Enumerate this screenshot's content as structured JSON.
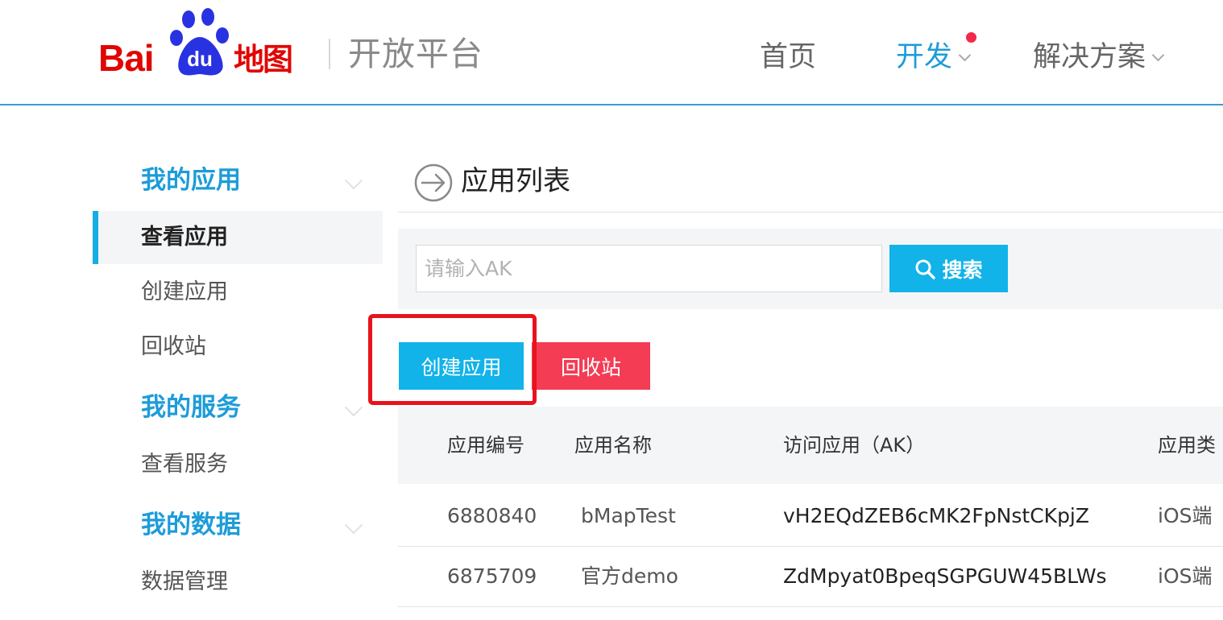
{
  "header": {
    "logo_text_bai": "Bai",
    "logo_text_du": "du",
    "logo_text_ditu": "地图",
    "platform_name": "开放平台",
    "nav": [
      {
        "label": "首页"
      },
      {
        "label": "开发"
      },
      {
        "label": "解决方案"
      }
    ],
    "notification_dot_color": "#f2294a"
  },
  "sidebar": {
    "sections": [
      {
        "title": "我的应用",
        "items": [
          "查看应用",
          "创建应用",
          "回收站"
        ]
      },
      {
        "title": "我的服务",
        "items": [
          "查看服务"
        ]
      },
      {
        "title": "我的数据",
        "items": [
          "数据管理"
        ]
      }
    ],
    "active_item": "查看应用"
  },
  "main": {
    "title": "应用列表",
    "search": {
      "placeholder": "请输入AK",
      "value": "",
      "button_label": "搜索"
    },
    "actions": {
      "create_label": "创建应用",
      "recycle_label": "回收站"
    },
    "table": {
      "columns": [
        "应用编号",
        "应用名称",
        "访问应用（AK）",
        "应用类"
      ],
      "rows": [
        {
          "id": "6880840",
          "name": "bMapTest",
          "ak": "vH2EQdZEB6cMK2FpNstCKpjZ",
          "type": "iOS端"
        },
        {
          "id": "6875709",
          "name": "官方demo",
          "ak": "ZdMpyat0BpeqSGPGUW45BLWs",
          "type": "iOS端"
        }
      ]
    }
  },
  "colors": {
    "brand_red": "#e10602",
    "accent_blue": "#11b3e9",
    "danger_red": "#f43c55",
    "highlight_border": "#e8131d"
  }
}
